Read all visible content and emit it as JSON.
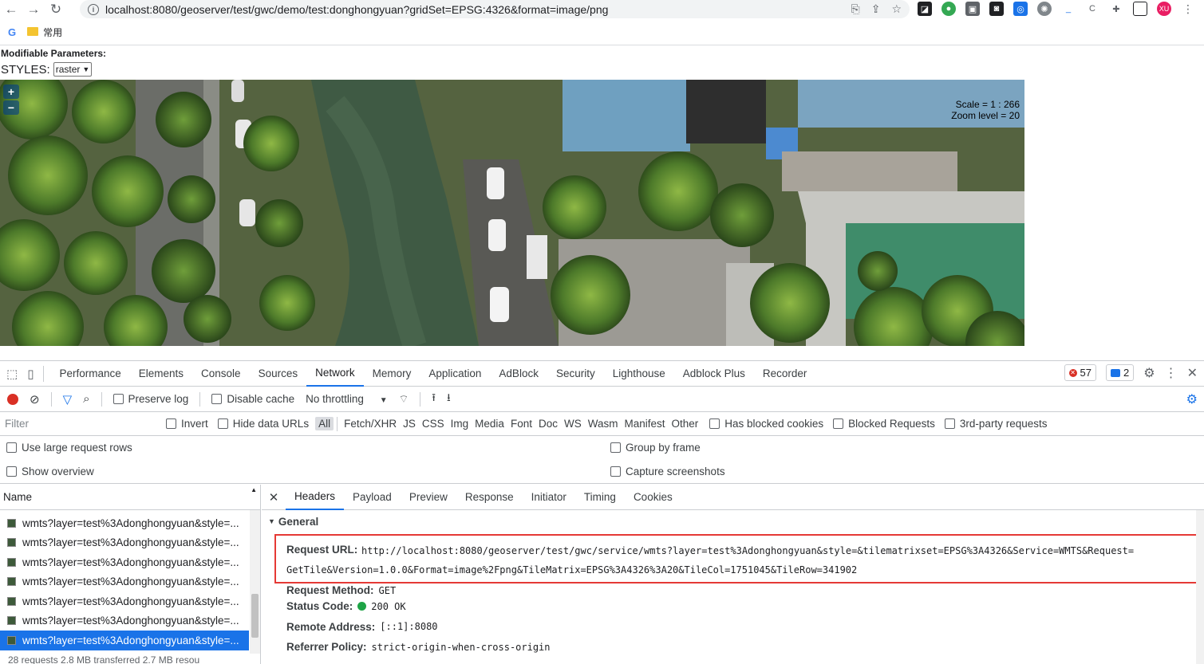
{
  "browser": {
    "url": "localhost:8080/geoserver/test/gwc/demo/test:donghongyuan?gridSet=EPSG:4326&format=image/png",
    "bookmark_folder": "常用",
    "google_letter": "G",
    "profile_initials": "XU"
  },
  "page": {
    "params_title": "Modifiable Parameters:",
    "styles_label": "STYLES:",
    "styles_value": "raster",
    "zoom_in": "+",
    "zoom_out": "−",
    "scale_text": "Scale = 1 : 266",
    "zoom_level_text": "Zoom level = 20"
  },
  "devtools": {
    "tabs": [
      "Performance",
      "Elements",
      "Console",
      "Sources",
      "Network",
      "Memory",
      "Application",
      "AdBlock",
      "Security",
      "Lighthouse",
      "Adblock Plus",
      "Recorder"
    ],
    "active_tab": "Network",
    "error_count": "57",
    "message_count": "2",
    "toolbar": {
      "preserve_log": "Preserve log",
      "disable_cache": "Disable cache",
      "throttling": "No throttling"
    },
    "filter": {
      "placeholder": "Filter",
      "invert": "Invert",
      "hide_data_urls": "Hide data URLs",
      "types": [
        "All",
        "Fetch/XHR",
        "JS",
        "CSS",
        "Img",
        "Media",
        "Font",
        "Doc",
        "WS",
        "Wasm",
        "Manifest",
        "Other"
      ],
      "has_blocked_cookies": "Has blocked cookies",
      "blocked_requests": "Blocked Requests",
      "third_party": "3rd-party requests"
    },
    "options": {
      "large_rows": "Use large request rows",
      "show_overview": "Show overview",
      "group_by_frame": "Group by frame",
      "capture_screenshots": "Capture screenshots"
    },
    "list": {
      "header": "Name",
      "rows": [
        "wmts?layer=test%3Adonghongyuan&style=...",
        "wmts?layer=test%3Adonghongyuan&style=...",
        "wmts?layer=test%3Adonghongyuan&style=...",
        "wmts?layer=test%3Adonghongyuan&style=...",
        "wmts?layer=test%3Adonghongyuan&style=...",
        "wmts?layer=test%3Adonghongyuan&style=...",
        "wmts?layer=test%3Adonghongyuan&style=..."
      ],
      "summary": "28 requests   2.8 MB transferred   2.7 MB resou"
    },
    "detail": {
      "tabs": [
        "Headers",
        "Payload",
        "Preview",
        "Response",
        "Initiator",
        "Timing",
        "Cookies"
      ],
      "active_tab": "Headers",
      "section": "General",
      "request_url_key": "Request URL:",
      "request_url_line1": "http://localhost:8080/geoserver/test/gwc/service/wmts?layer=test%3Adonghongyuan&style=&tilematrixset=EPSG%3A4326&Service=WMTS&Request=",
      "request_url_line2": "GetTile&Version=1.0.0&Format=image%2Fpng&TileMatrix=EPSG%3A4326%3A20&TileCol=1751045&TileRow=341902",
      "method_key": "Request Method:",
      "method_value": "GET",
      "status_key": "Status Code:",
      "status_value": "200 OK",
      "remote_key": "Remote Address:",
      "remote_value": "[::1]:8080",
      "referrer_key": "Referrer Policy:",
      "referrer_value": "strict-origin-when-cross-origin"
    }
  }
}
